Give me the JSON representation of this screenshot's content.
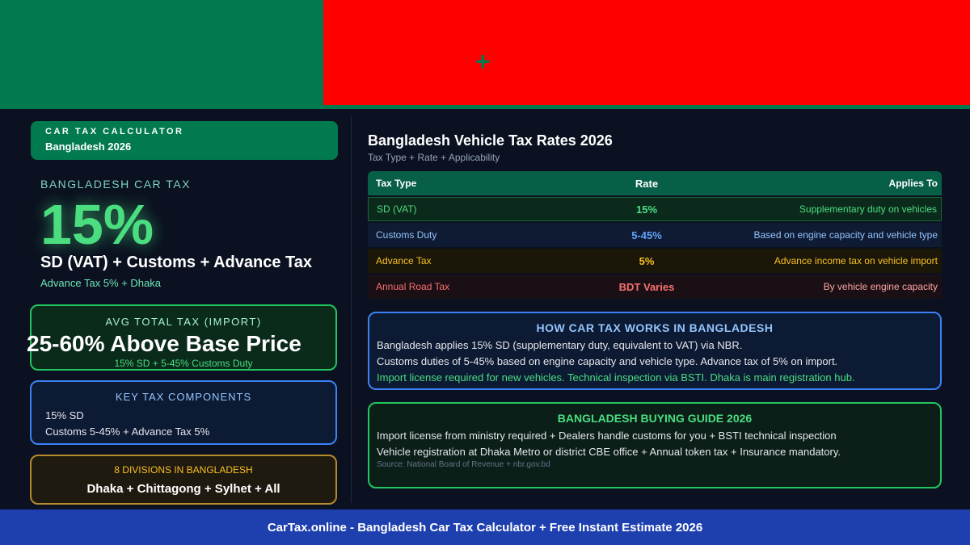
{
  "banner": {
    "plus_glyph": "+",
    "colors": {
      "green": "#027a4f",
      "red": "#ff0000"
    }
  },
  "left": {
    "calc_card": {
      "kicker": "CAR TAX CALCULATOR",
      "country": "Bangladesh 2026"
    },
    "headline_label": "BANGLADESH CAR TAX",
    "headline_rate": "15%",
    "headline_desc": "SD (VAT) + Customs + Advance Tax",
    "headline_sub": "Advance Tax 5% + Dhaka",
    "avg_card": {
      "label": "AVG TOTAL TAX (IMPORT)",
      "value": "25-60% Above Base Price",
      "sub": "15% SD + 5-45% Customs Duty"
    },
    "key_card": {
      "label": "KEY TAX COMPONENTS",
      "line1": "15% SD",
      "line2": "Customs 5-45% + Advance Tax 5%"
    },
    "divisions_card": {
      "label": "8 DIVISIONS IN BANGLADESH",
      "value": "Dhaka + Chittagong + Sylhet + All"
    }
  },
  "right": {
    "title": "Bangladesh Vehicle Tax Rates 2026",
    "subtitle": "Tax Type + Rate + Applicability",
    "table": {
      "headers": [
        "Tax Type",
        "Rate",
        "Applies To"
      ],
      "rows": [
        [
          "SD (VAT)",
          "15%",
          "Supplementary duty on vehicles"
        ],
        [
          "Customs Duty",
          "5-45%",
          "Based on engine capacity and vehicle type"
        ],
        [
          "Advance Tax",
          "5%",
          "Advance income tax on vehicle import"
        ],
        [
          "Annual Road Tax",
          "BDT Varies",
          "By vehicle engine capacity"
        ]
      ]
    },
    "how_card": {
      "title": "HOW CAR TAX WORKS IN BANGLADESH",
      "line1": "Bangladesh applies 15% SD (supplementary duty, equivalent to VAT) via NBR.",
      "line2": "Customs duties of 5-45% based on engine capacity and vehicle type. Advance tax of 5% on import.",
      "line3": "Import license required for new vehicles. Technical inspection via BSTI. Dhaka is main registration hub."
    },
    "guide_card": {
      "title": "BANGLADESH BUYING GUIDE 2026",
      "line1": "Import license from ministry required + Dealers handle customs for you + BSTI technical inspection",
      "line2": "Vehicle registration at Dhaka Metro or district CBE office + Annual token tax + Insurance mandatory.",
      "source": "Source: National Board of Revenue + nbr.gov.bd"
    }
  },
  "footer": {
    "text": "CarTax.online - Bangladesh Car Tax Calculator + Free Instant Estimate 2026"
  }
}
